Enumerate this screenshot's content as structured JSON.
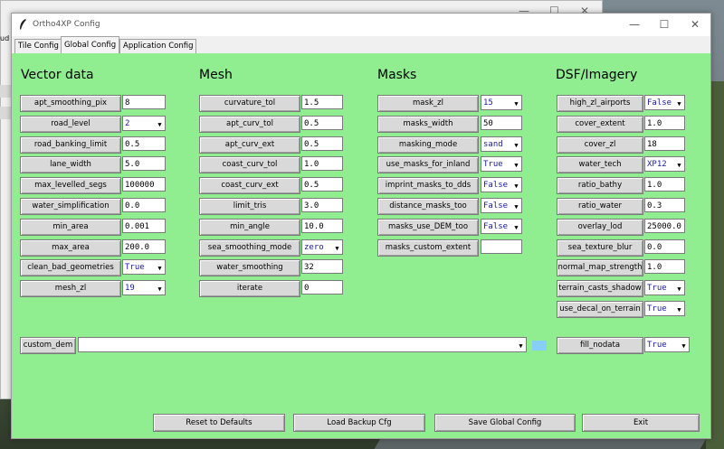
{
  "window": {
    "title": "Ortho4XP Config",
    "controls": {
      "minimize": "—",
      "maximize": "☐",
      "close": "✕"
    }
  },
  "background": {
    "behind_title_controls": [
      "—",
      "☐",
      "✕"
    ],
    "left_snippet": "ud"
  },
  "tabs": [
    {
      "label": "Tile Config",
      "active": false
    },
    {
      "label": "Global Config",
      "active": true
    },
    {
      "label": "Application Config",
      "active": false
    }
  ],
  "colors": {
    "panel_bg": "#90ee90",
    "combo_text": "#1a1aa0",
    "swatch": "#87cefa"
  },
  "vector": {
    "title": "Vector data",
    "rows": [
      {
        "label": "apt_smoothing_pix",
        "value": "8",
        "kind": "entry"
      },
      {
        "label": "road_level",
        "value": "2",
        "kind": "combo"
      },
      {
        "label": "road_banking_limit",
        "value": "0.5",
        "kind": "entry"
      },
      {
        "label": "lane_width",
        "value": "5.0",
        "kind": "entry"
      },
      {
        "label": "max_levelled_segs",
        "value": "100000",
        "kind": "entry"
      },
      {
        "label": "water_simplification",
        "value": "0.0",
        "kind": "entry"
      },
      {
        "label": "min_area",
        "value": "0.001",
        "kind": "entry"
      },
      {
        "label": "max_area",
        "value": "200.0",
        "kind": "entry"
      },
      {
        "label": "clean_bad_geometries",
        "value": "True",
        "kind": "combo"
      },
      {
        "label": "mesh_zl",
        "value": "19",
        "kind": "combo"
      }
    ]
  },
  "mesh": {
    "title": "Mesh",
    "rows": [
      {
        "label": "curvature_tol",
        "value": "1.5",
        "kind": "entry"
      },
      {
        "label": "apt_curv_tol",
        "value": "0.5",
        "kind": "entry"
      },
      {
        "label": "apt_curv_ext",
        "value": "0.5",
        "kind": "entry"
      },
      {
        "label": "coast_curv_tol",
        "value": "1.0",
        "kind": "entry"
      },
      {
        "label": "coast_curv_ext",
        "value": "0.5",
        "kind": "entry"
      },
      {
        "label": "limit_tris",
        "value": "3.0",
        "kind": "entry"
      },
      {
        "label": "min_angle",
        "value": "10.0",
        "kind": "entry"
      },
      {
        "label": "sea_smoothing_mode",
        "value": "zero",
        "kind": "combo"
      },
      {
        "label": "water_smoothing",
        "value": "32",
        "kind": "entry"
      },
      {
        "label": "iterate",
        "value": "0",
        "kind": "entry"
      }
    ]
  },
  "masks": {
    "title": "Masks",
    "rows": [
      {
        "label": "mask_zl",
        "value": "15",
        "kind": "combo"
      },
      {
        "label": "masks_width",
        "value": "50",
        "kind": "entry"
      },
      {
        "label": "masking_mode",
        "value": "sand",
        "kind": "combo"
      },
      {
        "label": "use_masks_for_inland",
        "value": "True",
        "kind": "combo"
      },
      {
        "label": "imprint_masks_to_dds",
        "value": "False",
        "kind": "combo"
      },
      {
        "label": "distance_masks_too",
        "value": "False",
        "kind": "combo"
      },
      {
        "label": "masks_use_DEM_too",
        "value": "False",
        "kind": "combo"
      },
      {
        "label": "masks_custom_extent",
        "value": "",
        "kind": "entry"
      }
    ]
  },
  "dsf": {
    "title": "DSF/Imagery",
    "rows": [
      {
        "label": "high_zl_airports",
        "value": "False",
        "kind": "combo"
      },
      {
        "label": "cover_extent",
        "value": "1.0",
        "kind": "entry"
      },
      {
        "label": "cover_zl",
        "value": "18",
        "kind": "entry"
      },
      {
        "label": "water_tech",
        "value": "XP12",
        "kind": "combo"
      },
      {
        "label": "ratio_bathy",
        "value": "1.0",
        "kind": "entry"
      },
      {
        "label": "ratio_water",
        "value": "0.3",
        "kind": "entry"
      },
      {
        "label": "overlay_lod",
        "value": "25000.0",
        "kind": "entry"
      },
      {
        "label": "sea_texture_blur",
        "value": "0.0",
        "kind": "entry"
      },
      {
        "label": "normal_map_strength",
        "value": "1.0",
        "kind": "entry"
      },
      {
        "label": "terrain_casts_shadow",
        "value": "True",
        "kind": "combo"
      },
      {
        "label": "use_decal_on_terrain",
        "value": "True",
        "kind": "combo"
      }
    ]
  },
  "custom_dem": {
    "label": "custom_dem",
    "value": ""
  },
  "fill_nodata": {
    "label": "fill_nodata",
    "value": "True"
  },
  "bottom_buttons": {
    "reset": "Reset to Defaults",
    "load_backup": "Load Backup Cfg",
    "save": "Save Global Config",
    "exit": "Exit"
  }
}
